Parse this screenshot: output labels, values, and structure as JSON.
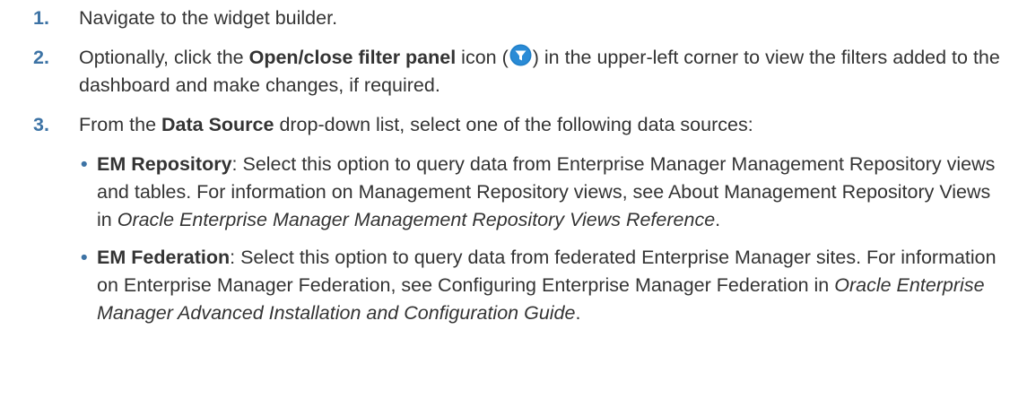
{
  "colors": {
    "step_number": "#3d73a5",
    "text": "#333333",
    "icon_fill": "#1f7fc8"
  },
  "steps": [
    {
      "number": "1.",
      "text": "Navigate to the widget builder."
    },
    {
      "number": "2.",
      "prefix": "Optionally, click the ",
      "bold": "Open/close filter panel",
      "mid": " icon (",
      "icon": "filter-funnel-icon",
      "suffix": ") in the upper-left corner to view the filters added to the dashboard and make changes, if required."
    },
    {
      "number": "3.",
      "prefix": "From the ",
      "bold": "Data Source",
      "suffix": " drop-down list, select one of the following data sources:",
      "bullets": [
        {
          "marker": "•",
          "bold": "EM Repository",
          "text1": ": Select this option to query data from Enterprise Manager Management Repository views and tables. For information on Management Repository views, see About Management Repository Views in ",
          "italic": "Oracle Enterprise Manager Management Repository Views Reference",
          "text2": "."
        },
        {
          "marker": "•",
          "bold": "EM Federation",
          "text1": ": Select this option to query data from federated Enterprise Manager sites. For information on Enterprise Manager Federation, see Configuring Enterprise Manager Federation in ",
          "italic": "Oracle Enterprise Manager Advanced Installation and Configuration Guide",
          "text2": "."
        }
      ]
    }
  ]
}
